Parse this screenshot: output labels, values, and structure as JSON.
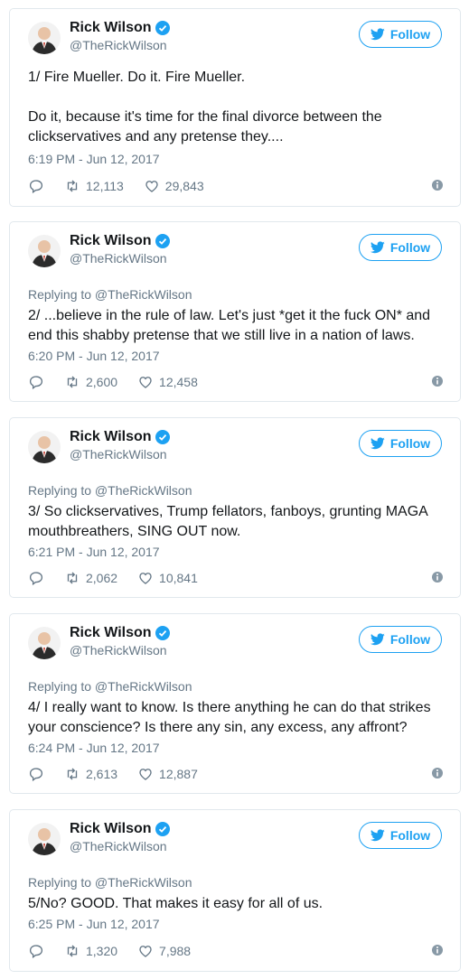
{
  "tweets": [
    {
      "name": "Rick Wilson",
      "handle": "@TheRickWilson",
      "follow_label": "Follow",
      "replying": "",
      "text": "1/ Fire Mueller. Do it. Fire Mueller.\n\nDo it, because it's time for the final divorce between the clickservatives and any pretense they....",
      "time": "6:19 PM - Jun 12, 2017",
      "retweets": "12,113",
      "likes": "29,843"
    },
    {
      "name": "Rick Wilson",
      "handle": "@TheRickWilson",
      "follow_label": "Follow",
      "replying": "Replying to @TheRickWilson",
      "text": "2/ ...believe in the rule of law. Let's just *get it the fuck ON* and end this shabby pretense that we still live in a nation of laws.",
      "time": "6:20 PM - Jun 12, 2017",
      "retweets": "2,600",
      "likes": "12,458"
    },
    {
      "name": "Rick Wilson",
      "handle": "@TheRickWilson",
      "follow_label": "Follow",
      "replying": "Replying to @TheRickWilson",
      "text": "3/ So clickservatives, Trump fellators, fanboys, grunting MAGA mouthbreathers, SING OUT now.",
      "time": "6:21 PM - Jun 12, 2017",
      "retweets": "2,062",
      "likes": "10,841"
    },
    {
      "name": "Rick Wilson",
      "handle": "@TheRickWilson",
      "follow_label": "Follow",
      "replying": "Replying to @TheRickWilson",
      "text": "4/ I really want to know. Is there anything he can do that strikes your conscience? Is there any sin, any excess, any affront?",
      "time": "6:24 PM - Jun 12, 2017",
      "retweets": "2,613",
      "likes": "12,887"
    },
    {
      "name": "Rick Wilson",
      "handle": "@TheRickWilson",
      "follow_label": "Follow",
      "replying": "Replying to @TheRickWilson",
      "text": "5/No? GOOD. That makes it easy for all of us.",
      "time": "6:25 PM - Jun 12, 2017",
      "retweets": "1,320",
      "likes": "7,988"
    }
  ],
  "icons": {
    "verified": "verified-badge-icon",
    "bird": "twitter-bird-icon",
    "reply": "reply-icon",
    "retweet": "retweet-icon",
    "like": "heart-icon",
    "info": "info-icon"
  },
  "colors": {
    "accent": "#1da1f2",
    "secondary_text": "#657786",
    "border": "#e1e8ed"
  }
}
